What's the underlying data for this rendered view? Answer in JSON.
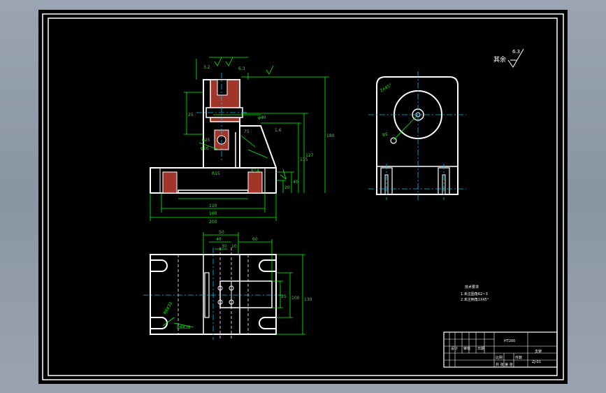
{
  "colors": {
    "canvas": "#000000",
    "part_outline": "#ffffff",
    "dimension": "#00ff00",
    "centerline": "#00bfff",
    "section_hatch": "#a0352a",
    "sheet_border": "#ffffff"
  },
  "surface_finish": {
    "label": "其余",
    "value": "6.3"
  },
  "front_view_dims": {
    "d_110": "110",
    "d_160": "160",
    "d_200": "200",
    "d_180": "180",
    "d_127": "127",
    "d_115": "115",
    "d_40": "40",
    "d_20": "20",
    "d_75": "75",
    "d_25": "25",
    "d_phi25": "φ25",
    "d_phi40": "φ40",
    "d_r15": "R15",
    "d_r14": "R14",
    "d_phi16": "φ16",
    "rough_top": "3.2",
    "rough_mid": "6.3",
    "rough_side": "1.6"
  },
  "side_view_dims": {
    "chamfer": "2X45°",
    "hole": "φ5"
  },
  "top_view_dims": {
    "d_50": "50",
    "d_40": "40",
    "d_30": "30",
    "d_10": "10",
    "d_60": "60",
    "d_25": "25",
    "d_100": "100",
    "d_130": "130",
    "d_slot": "R6X32",
    "d_slot2": "R6X32"
  },
  "tech_notes": {
    "title": "技术要求",
    "line1": "1.未注圆角R2~3",
    "line2": "2.未注倒角1X45°"
  },
  "title_block": {
    "part_name": "支架",
    "material": "HT200",
    "drawing_no": "ZJ-01",
    "scale_label": "比例",
    "qty_label": "件数",
    "designer_label": "设计",
    "checker_label": "审核",
    "date_label": "日期",
    "sheet_label": "共 张 第 张"
  }
}
